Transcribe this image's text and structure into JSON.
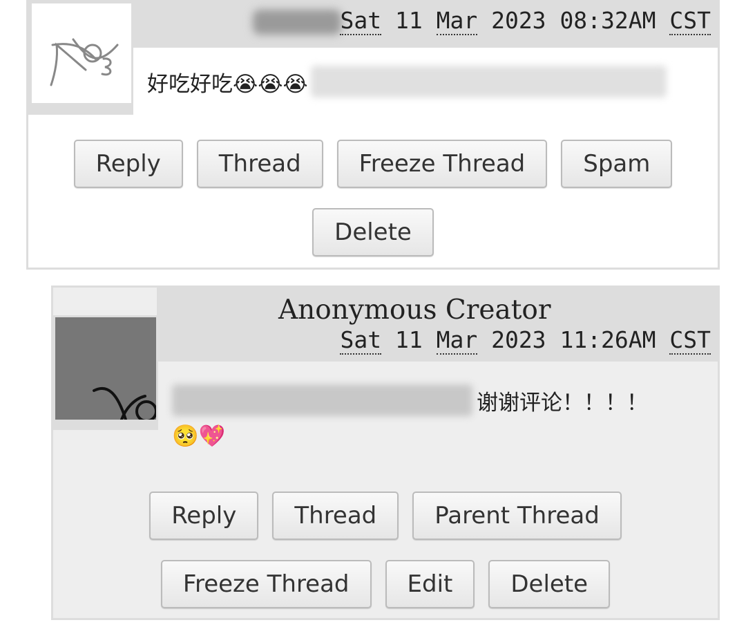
{
  "comments": [
    {
      "author": "",
      "date": {
        "weekday": "Sat",
        "day": "11",
        "month": "Mar",
        "year": "2023",
        "time": "08:32AM",
        "tz": "CST"
      },
      "text": "好吃好吃😭😭😭",
      "buttons_row1": [
        "Reply",
        "Thread",
        "Freeze Thread",
        "Spam"
      ],
      "buttons_row2": [
        "Delete"
      ]
    },
    {
      "author": "Anonymous Creator",
      "date": {
        "weekday": "Sat",
        "day": "11",
        "month": "Mar",
        "year": "2023",
        "time": "11:26AM",
        "tz": "CST"
      },
      "text": "谢谢评论！！！！",
      "emojis": "🥺💖",
      "buttons_row1": [
        "Reply",
        "Thread",
        "Parent Thread"
      ],
      "buttons_row2": [
        "Freeze Thread",
        "Edit",
        "Delete"
      ]
    }
  ]
}
